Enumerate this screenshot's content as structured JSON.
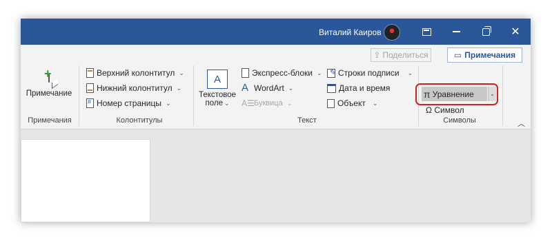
{
  "titlebar": {
    "user_name": "Виталий Каиров",
    "accent_color": "#2b579a",
    "controls": [
      "ribbon-display-options",
      "minimize",
      "restore",
      "close"
    ]
  },
  "top_actions": {
    "share_label": "Поделиться",
    "comments_label": "Примечания"
  },
  "groups": {
    "comments": {
      "label": "Примечания",
      "new_comment_label": "Примечание"
    },
    "header_footer": {
      "label": "Колонтитулы",
      "header_label": "Верхний колонтитул",
      "footer_label": "Нижний колонтитул",
      "page_number_label": "Номер страницы"
    },
    "text": {
      "label": "Текст",
      "text_box_label_line1": "Текстовое",
      "text_box_label_line2": "поле",
      "quick_parts_label": "Экспресс-блоки",
      "wordart_label": "WordArt",
      "dropcap_label": "Буквица",
      "signature_line_label": "Строки подписи",
      "date_time_label": "Дата и время",
      "object_label": "Объект"
    },
    "symbols": {
      "label": "Символы",
      "equation_label": "Уравнение",
      "symbol_label": "Символ",
      "highlight_color": "#d11f26"
    }
  }
}
